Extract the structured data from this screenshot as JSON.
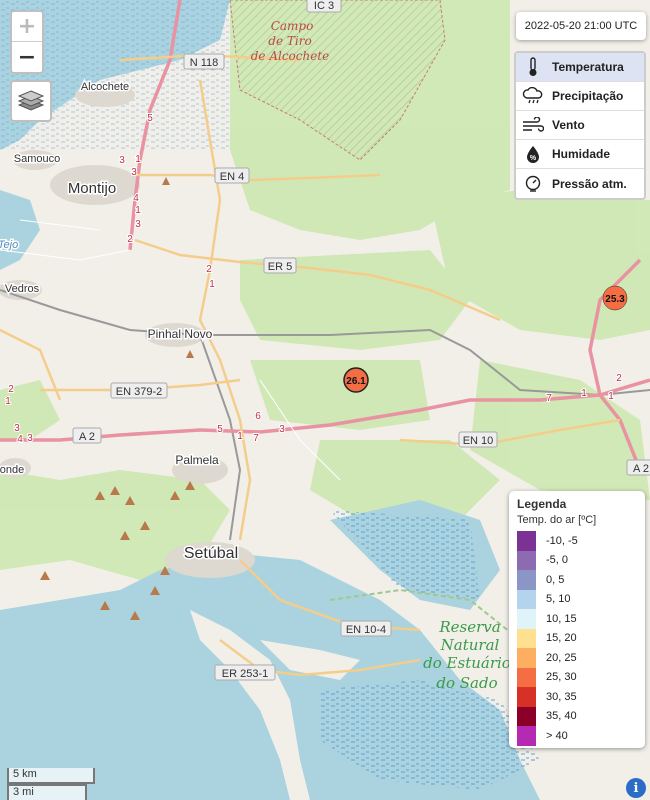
{
  "map": {
    "place_labels": [
      {
        "id": "alcochete",
        "text": "Alcochete"
      },
      {
        "id": "samouco",
        "text": "Samouco"
      },
      {
        "id": "montijo",
        "text": "Montijo"
      },
      {
        "id": "vedros",
        "text": "Vedros"
      },
      {
        "id": "pinhal-novo",
        "text": "Pinhal Novo"
      },
      {
        "id": "palmela",
        "text": "Palmela"
      },
      {
        "id": "setubal",
        "text": "Setúbal"
      },
      {
        "id": "onde",
        "text": "onde"
      },
      {
        "id": "tejo",
        "text": "Tejo"
      }
    ],
    "military_label": [
      "Campo",
      "de Tiro",
      "de Alcochete"
    ],
    "reserve_label": [
      "Reserva",
      "Natural",
      "do Estuário",
      "do Sado"
    ],
    "road_shields": [
      {
        "id": "ic3",
        "text": "IC 3"
      },
      {
        "id": "n118",
        "text": "N 118"
      },
      {
        "id": "en4",
        "text": "EN 4"
      },
      {
        "id": "er5",
        "text": "ER 5"
      },
      {
        "id": "en379-2",
        "text": "EN 379-2"
      },
      {
        "id": "a2-west",
        "text": "A 2"
      },
      {
        "id": "en10",
        "text": "EN 10"
      },
      {
        "id": "a2-east",
        "text": "A 2"
      },
      {
        "id": "en10-4",
        "text": "EN 10-4"
      },
      {
        "id": "er253-1",
        "text": "ER 253-1"
      }
    ],
    "road_numbers": [
      "5",
      "3",
      "1",
      "3",
      "4",
      "1",
      "3",
      "2",
      "2",
      "1",
      "2",
      "1",
      "3",
      "4",
      "3",
      "5",
      "1",
      "3",
      "6",
      "7",
      "7",
      "1",
      "1",
      "2"
    ],
    "stations": [
      {
        "id": "station-26-1",
        "value": "26.1",
        "color": "#f46d43"
      },
      {
        "id": "station-25-3",
        "value": "25.3",
        "color": "#f46d43"
      }
    ]
  },
  "controls": {
    "zoom_in": "+",
    "zoom_out": "−",
    "layers_icon": "layers-icon"
  },
  "timestamp": "2022-05-20 21:00 UTC",
  "variables": [
    {
      "id": "temperatura",
      "label": "Temperatura",
      "icon": "thermometer-icon",
      "active": true
    },
    {
      "id": "precipitacao",
      "label": "Precipitação",
      "icon": "rain-cloud-icon",
      "active": false
    },
    {
      "id": "vento",
      "label": "Vento",
      "icon": "wind-icon",
      "active": false
    },
    {
      "id": "humidade",
      "label": "Humidade",
      "icon": "humidity-drop-icon",
      "active": false
    },
    {
      "id": "pressao",
      "label": "Pressão atm.",
      "icon": "barometer-icon",
      "active": false
    }
  ],
  "legend": {
    "title": "Legenda",
    "subtitle": "Temp. do ar [ºC]",
    "items": [
      {
        "label": "-10, -5",
        "color": "#7b3294"
      },
      {
        "label": "-5, 0",
        "color": "#8c6bb1"
      },
      {
        "label": "0, 5",
        "color": "#8c96c6"
      },
      {
        "label": "5, 10",
        "color": "#b3d4ec"
      },
      {
        "label": "10, 15",
        "color": "#e0f3f8"
      },
      {
        "label": "15, 20",
        "color": "#fee090"
      },
      {
        "label": "20, 25",
        "color": "#fdae61"
      },
      {
        "label": "25, 30",
        "color": "#f46d43"
      },
      {
        "label": "30, 35",
        "color": "#d73027"
      },
      {
        "label": "35, 40",
        "color": "#8b0026"
      },
      {
        "label": "> 40",
        "color": "#b42ab3"
      }
    ]
  },
  "scale": {
    "km": "5 km",
    "mi": "3 mi"
  },
  "info_icon": "info-icon"
}
